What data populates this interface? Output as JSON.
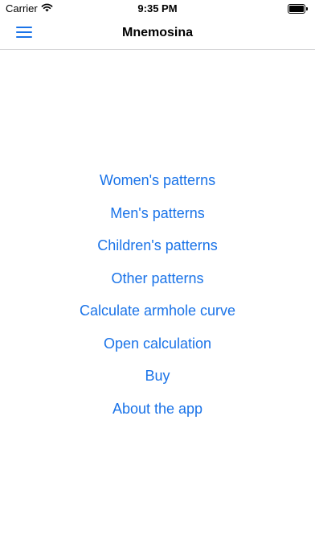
{
  "status_bar": {
    "carrier": "Carrier",
    "time": "9:35 PM",
    "battery_level": 1.0,
    "wifi_icon": "wifi-icon",
    "battery_icon": "battery-icon"
  },
  "nav": {
    "title": "Mnemosina",
    "menu_icon": "hamburger-menu-icon",
    "accent_color": "#1a73e8"
  },
  "menu": {
    "items": [
      {
        "label": "Women's patterns"
      },
      {
        "label": "Men's patterns"
      },
      {
        "label": "Children's patterns"
      },
      {
        "label": "Other patterns"
      },
      {
        "label": "Calculate armhole curve"
      },
      {
        "label": "Open calculation"
      },
      {
        "label": "Buy"
      },
      {
        "label": "About the app"
      }
    ]
  }
}
